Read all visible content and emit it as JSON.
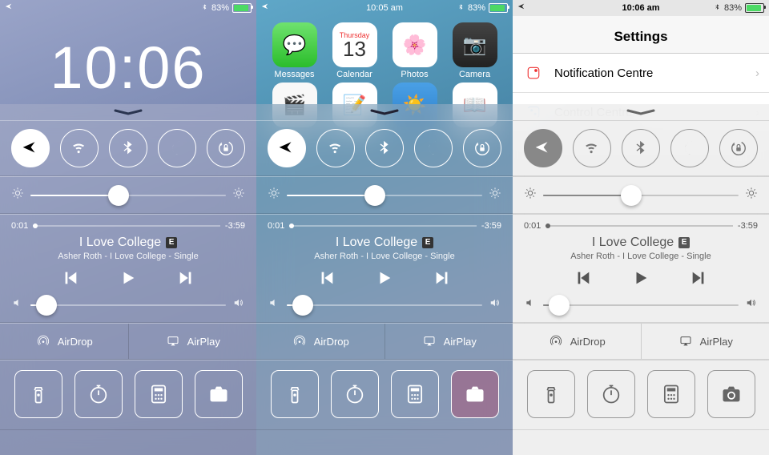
{
  "status": {
    "battery_pct": "83%",
    "time_home": "10:05 am",
    "time_settings": "10:06 am"
  },
  "lock": {
    "clock": "10:06"
  },
  "home": {
    "calendar_day": "Thursday",
    "calendar_date": "13",
    "apps_row1": [
      "Messages",
      "Calendar",
      "Photos",
      "Camera"
    ]
  },
  "settings": {
    "title": "Settings",
    "rows": [
      "Notification Centre",
      "Control Centre"
    ]
  },
  "cc": {
    "brightness_pct": 45,
    "scrub_elapsed": "0:01",
    "scrub_remaining": "-3:59",
    "song_title": "I Love College",
    "explicit": "E",
    "song_sub": "Asher Roth - I Love College - Single",
    "volume_pct": 8,
    "airdrop": "AirDrop",
    "airplay": "AirPlay"
  }
}
